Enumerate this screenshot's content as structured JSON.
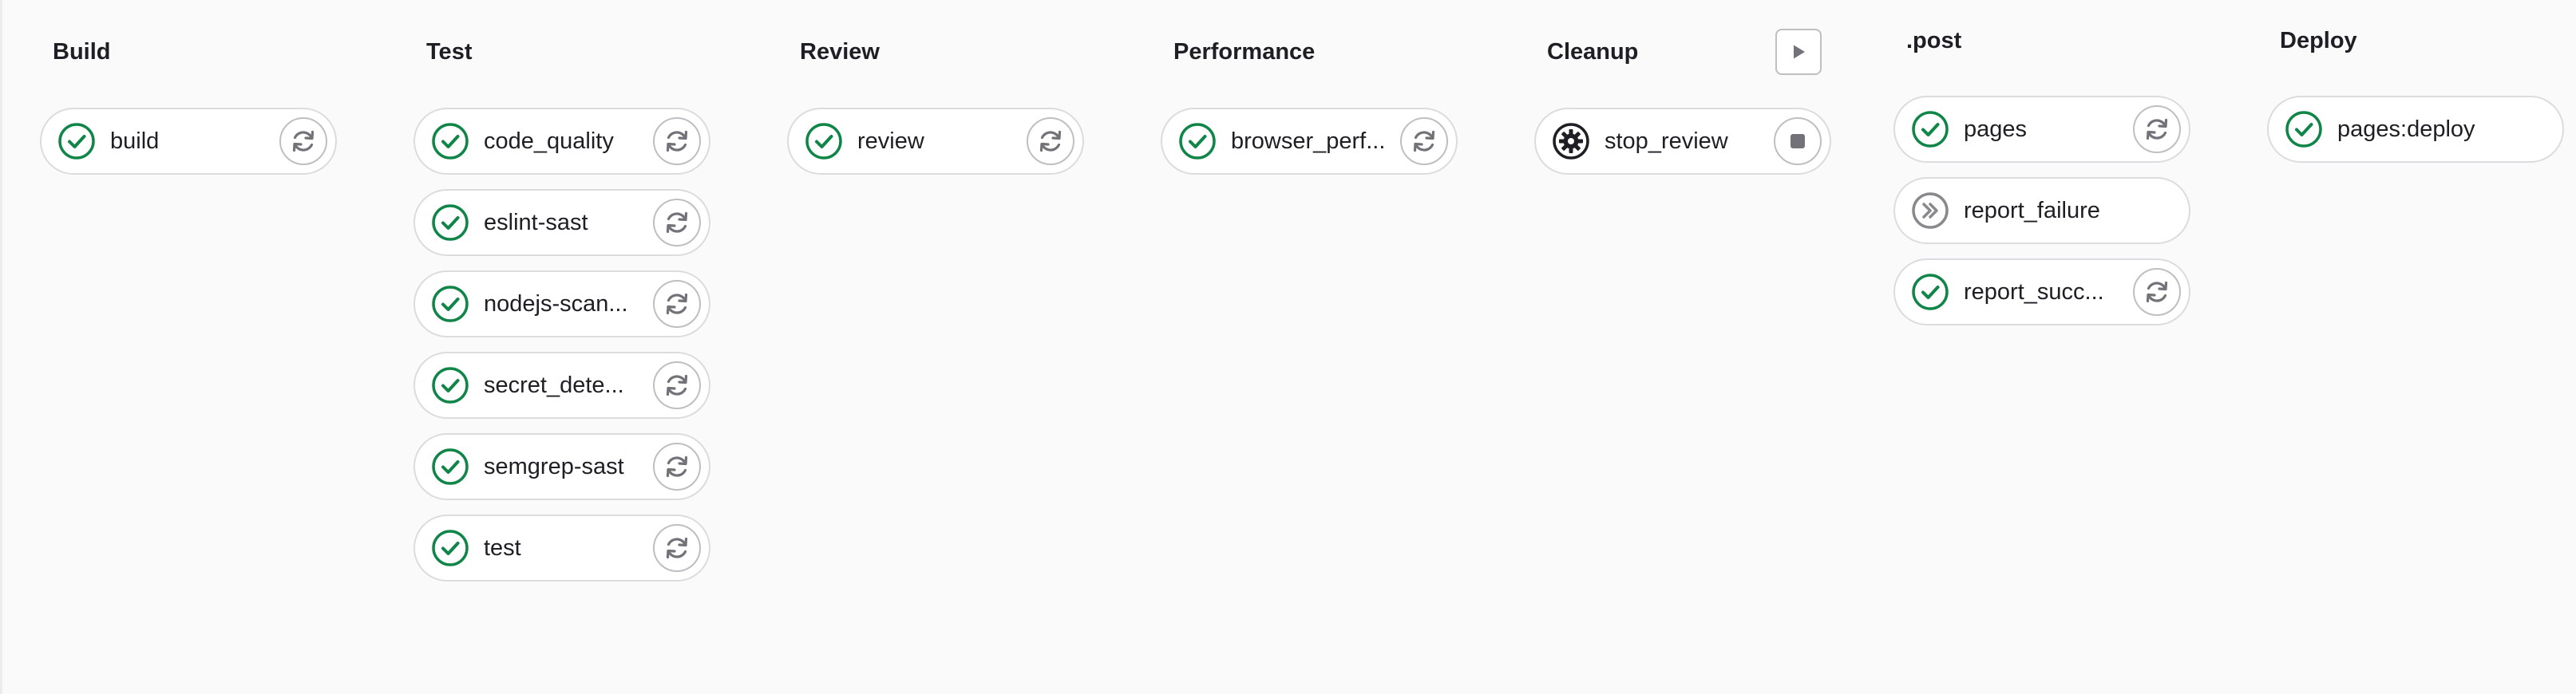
{
  "stages": [
    {
      "title": "Build",
      "jobs": [
        {
          "name": "build",
          "status": "success",
          "action": "retry"
        }
      ]
    },
    {
      "title": "Test",
      "jobs": [
        {
          "name": "code_quality",
          "status": "success",
          "action": "retry"
        },
        {
          "name": "eslint-sast",
          "status": "success",
          "action": "retry"
        },
        {
          "name": "nodejs-scan...",
          "status": "success",
          "action": "retry"
        },
        {
          "name": "secret_dete...",
          "status": "success",
          "action": "retry"
        },
        {
          "name": "semgrep-sast",
          "status": "success",
          "action": "retry"
        },
        {
          "name": "test",
          "status": "success",
          "action": "retry"
        }
      ]
    },
    {
      "title": "Review",
      "jobs": [
        {
          "name": "review",
          "status": "success",
          "action": "retry"
        }
      ]
    },
    {
      "title": "Performance",
      "jobs": [
        {
          "name": "browser_perf...",
          "status": "success",
          "action": "retry"
        }
      ]
    },
    {
      "title": "Cleanup",
      "stage_action": "play",
      "jobs": [
        {
          "name": "stop_review",
          "status": "manual",
          "action": "stop"
        }
      ]
    },
    {
      "title": ".post",
      "jobs": [
        {
          "name": "pages",
          "status": "success",
          "action": "retry"
        },
        {
          "name": "report_failure",
          "status": "skipped",
          "action": "none"
        },
        {
          "name": "report_succ...",
          "status": "success",
          "action": "retry"
        }
      ]
    },
    {
      "title": "Deploy",
      "jobs": [
        {
          "name": "pages:deploy",
          "status": "success",
          "action": "none"
        }
      ]
    }
  ],
  "colors": {
    "success": "#108548",
    "skipped": "#89888d",
    "manual": "#1f1e24",
    "action_icon": "#737278",
    "page_background": "#fafafa"
  },
  "icons": {
    "success": "check-circle-icon",
    "skipped": "skipped-icon",
    "manual": "gear-icon",
    "retry": "retry-icon",
    "stop": "stop-icon",
    "play": "play-icon"
  }
}
